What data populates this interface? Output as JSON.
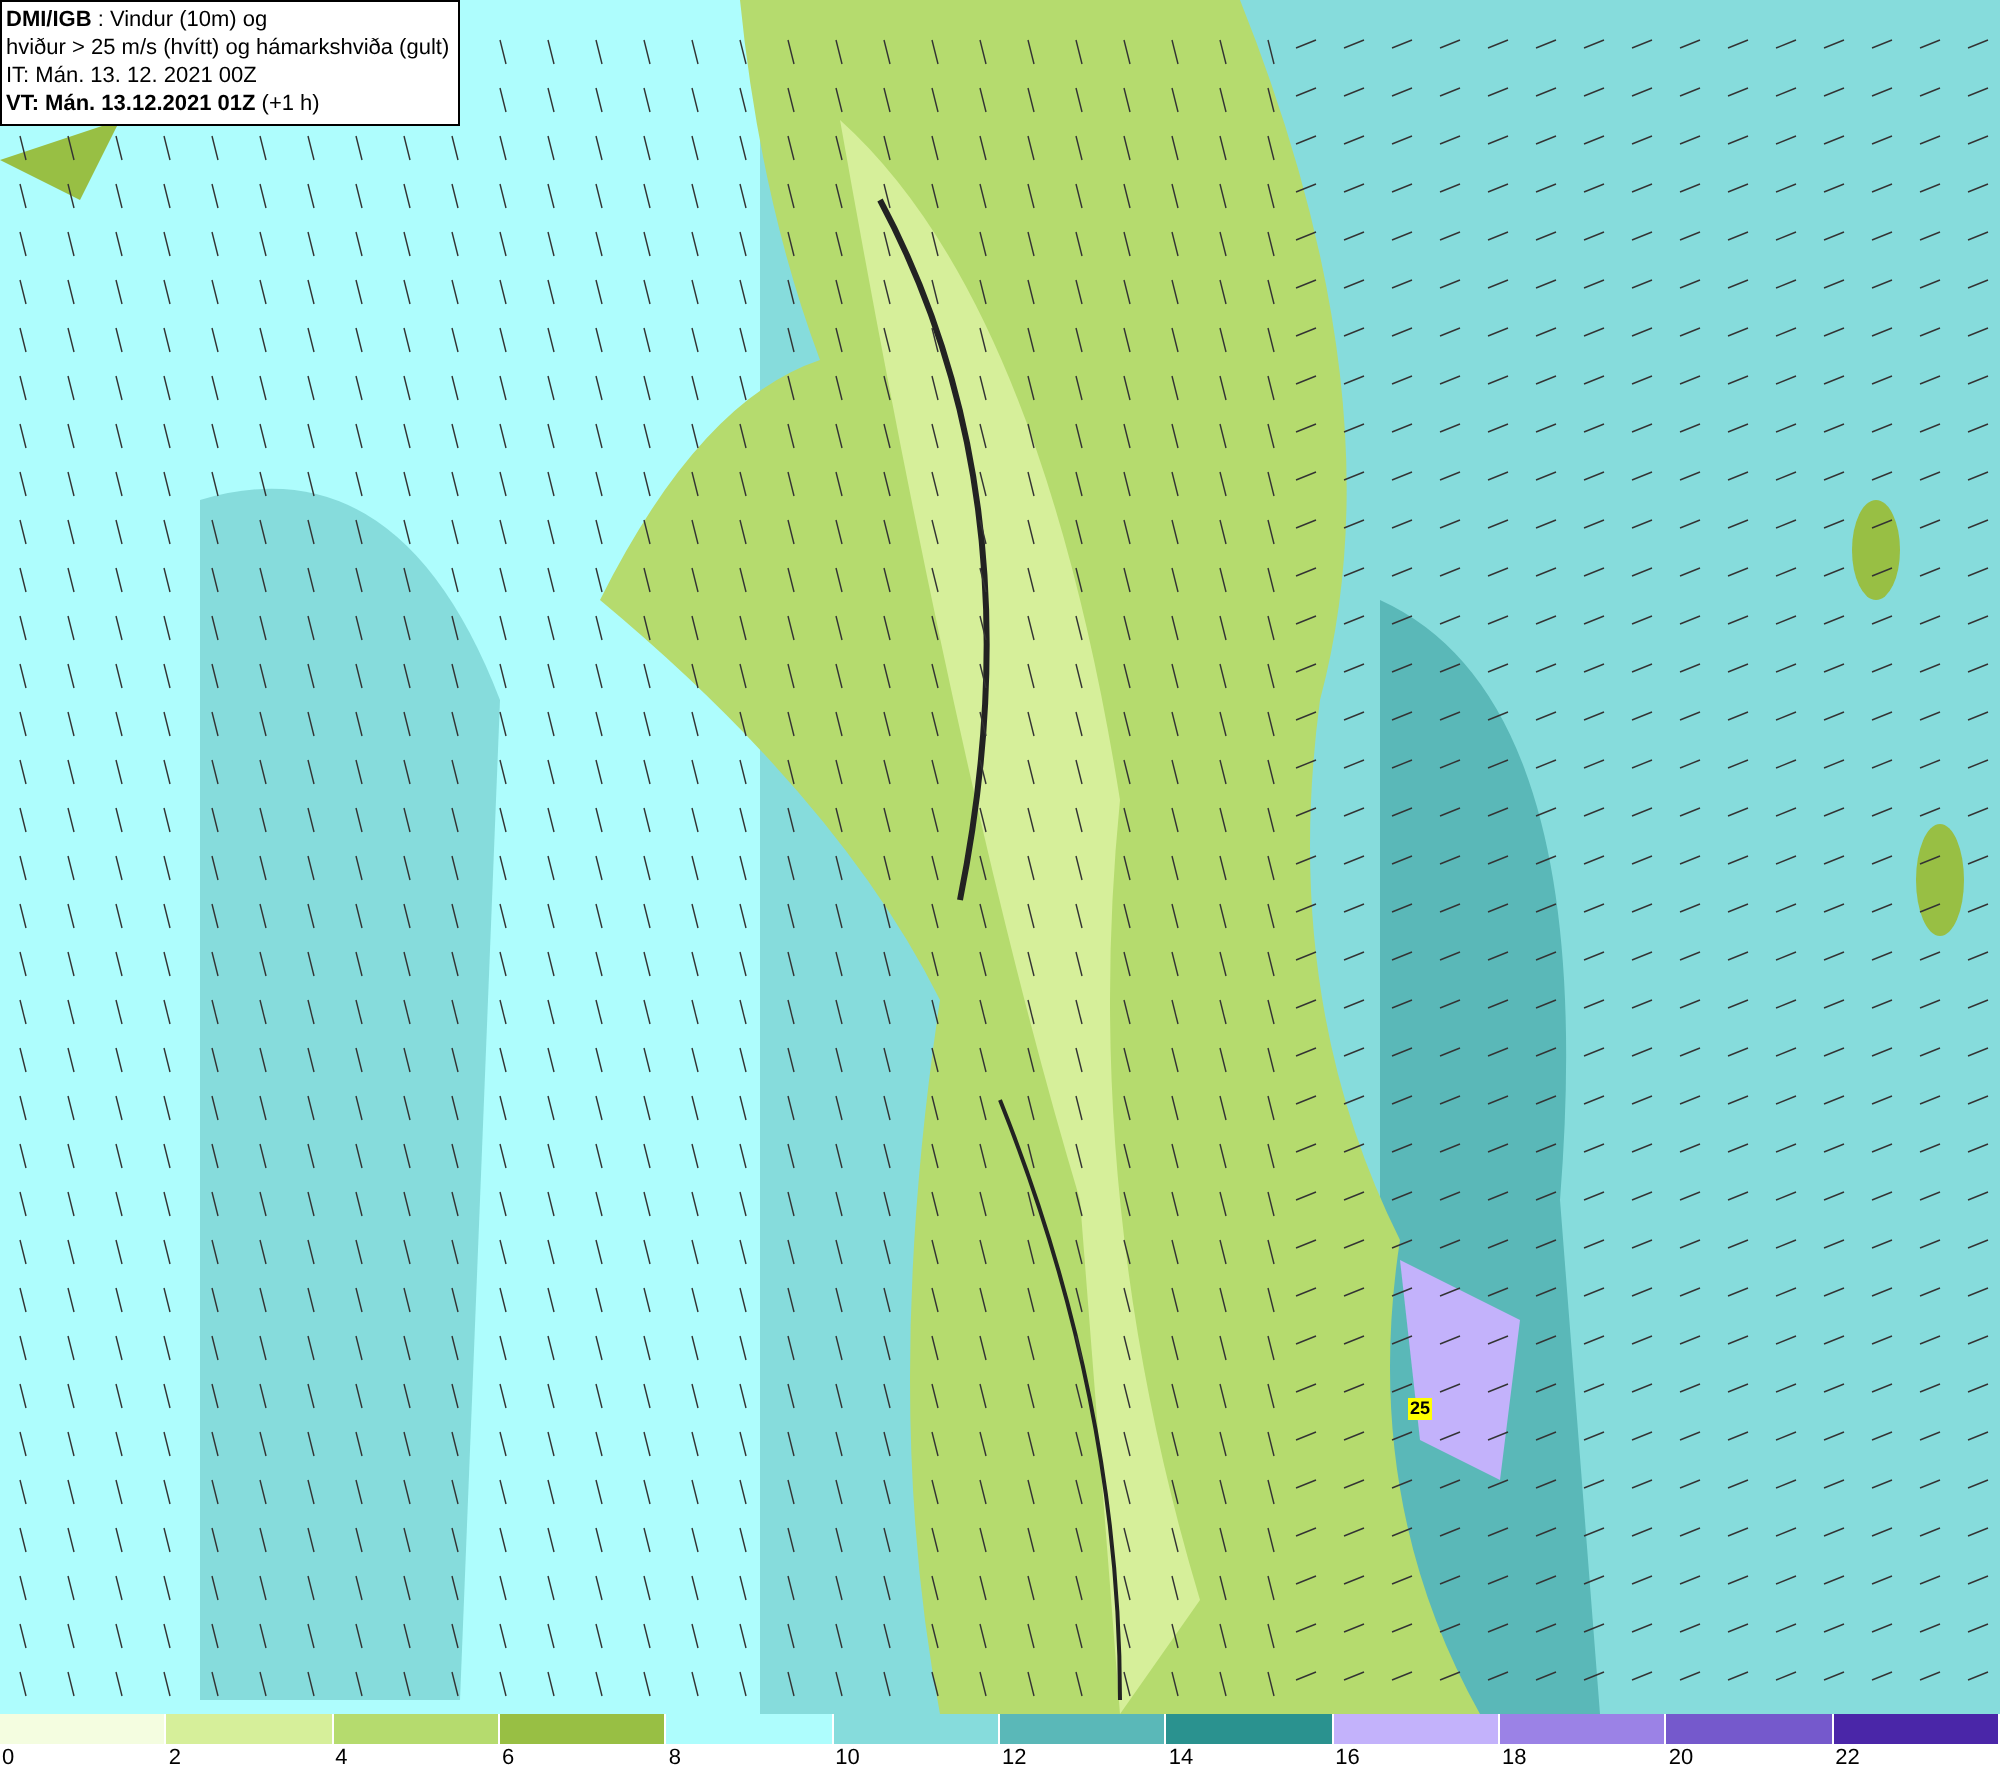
{
  "header": {
    "lines": [
      "**DMI/IGB** : Vindur (10m) og",
      "hviður > 25 m/s (hvítt) og hámarkshviða (gult)",
      "IT: Mán. 13. 12. 2021 00Z",
      "**VT: Mán. 13.12.2021 01Z** (+1 h)"
    ]
  },
  "map": {
    "gust_marker": "25"
  },
  "legend": [
    {
      "label": "0",
      "color": "#f4fde0"
    },
    {
      "label": "2",
      "color": "#d6ef9a"
    },
    {
      "label": "4",
      "color": "#b5db6e"
    },
    {
      "label": "6",
      "color": "#98bf44"
    },
    {
      "label": "8",
      "color": "#aefdfd"
    },
    {
      "label": "10",
      "color": "#86dcdc"
    },
    {
      "label": "12",
      "color": "#5ab8b8"
    },
    {
      "label": "14",
      "color": "#2a928f"
    },
    {
      "label": "16",
      "color": "#c3b2fb"
    },
    {
      "label": "18",
      "color": "#9b82e6"
    },
    {
      "label": "20",
      "color": "#7559cc"
    },
    {
      "label": "22",
      "color": "#4a26a8"
    }
  ]
}
